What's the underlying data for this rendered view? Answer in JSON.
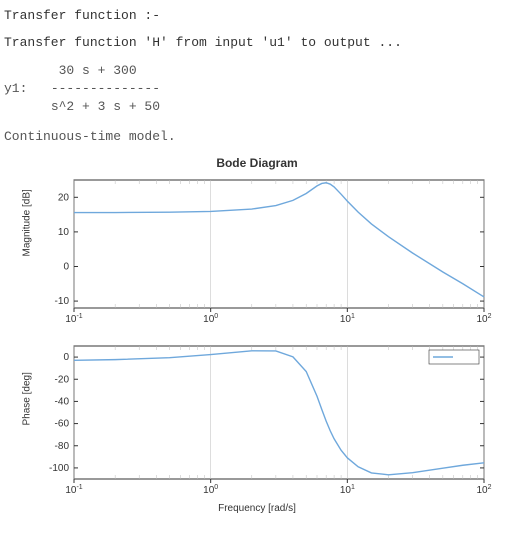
{
  "header": {
    "line1": "Transfer function :-",
    "line2": "Transfer function 'H' from input 'u1' to output ..."
  },
  "tf": {
    "label": "y1:",
    "numerator": "30 s + 300",
    "rule": "--------------",
    "denominator": "s^2 + 3 s + 50"
  },
  "cont_time": "Continuous-time model.",
  "chart_data": [
    {
      "type": "line",
      "title": "Bode Diagram",
      "xlabel": "",
      "ylabel": "Magnitude [dB]",
      "xscale": "log",
      "xlim": [
        0.1,
        100
      ],
      "ylim": [
        -12,
        25
      ],
      "xticks": [
        0.1,
        1,
        10,
        100
      ],
      "yticks": [
        -10,
        0,
        10,
        20
      ],
      "x": [
        0.1,
        0.2,
        0.5,
        1,
        2,
        3,
        4,
        5,
        6,
        6.5,
        7,
        7.5,
        8,
        9,
        10,
        12,
        15,
        20,
        30,
        50,
        70,
        100
      ],
      "values": [
        15.6,
        15.6,
        15.7,
        15.9,
        16.6,
        17.6,
        19.1,
        21.1,
        23.3,
        24.0,
        24.2,
        23.8,
        23.0,
        20.9,
        18.9,
        15.7,
        12.3,
        8.6,
        3.9,
        -1.6,
        -5.0,
        -8.8
      ]
    },
    {
      "type": "line",
      "title": "",
      "xlabel": "Frequency [rad/s]",
      "ylabel": "Phase [deg]",
      "xscale": "log",
      "xlim": [
        0.1,
        100
      ],
      "ylim": [
        -110,
        10
      ],
      "xticks": [
        0.1,
        1,
        10,
        100
      ],
      "yticks": [
        -100,
        -80,
        -60,
        -40,
        -20,
        0
      ],
      "x": [
        0.1,
        0.2,
        0.5,
        1,
        2,
        3,
        4,
        5,
        6,
        6.5,
        7,
        7.5,
        8,
        9,
        10,
        12,
        15,
        20,
        30,
        50,
        70,
        100
      ],
      "values": [
        -2.9,
        -2.3,
        -0.5,
        2.3,
        5.7,
        5.5,
        0.2,
        -13.0,
        -35.3,
        -47.2,
        -57.8,
        -66.6,
        -73.7,
        -84.0,
        -90.9,
        -99.0,
        -104.5,
        -106.2,
        -104.3,
        -100.2,
        -97.6,
        -95.4
      ],
      "legend_present": true
    }
  ]
}
